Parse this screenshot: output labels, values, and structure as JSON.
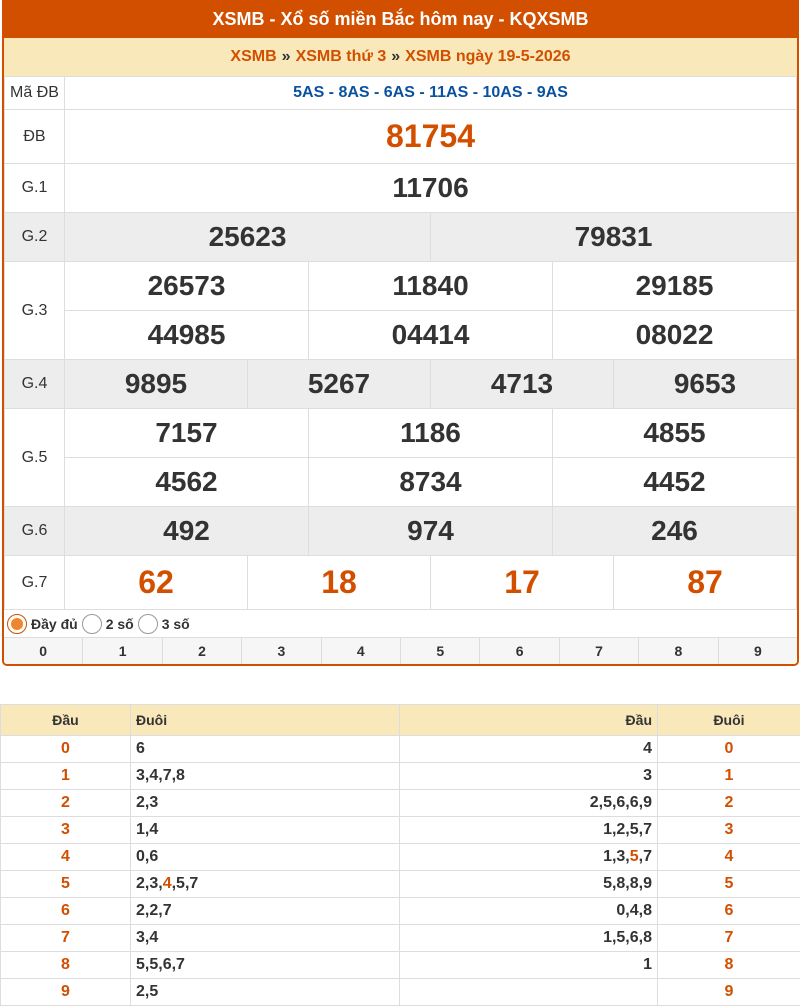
{
  "header": {
    "title": "XSMB - Xổ số miền Bắc hôm nay - KQXSMB"
  },
  "breadcrumb": {
    "items": [
      "XSMB",
      "XSMB thứ 3",
      "XSMB ngày 19-5-2026"
    ],
    "separator": "»"
  },
  "results": {
    "ma_db_label": "Mã ĐB",
    "ma_db_value": "5AS - 8AS - 6AS - 11AS - 10AS - 9AS",
    "db_label": "ĐB",
    "db": "81754",
    "g1_label": "G.1",
    "g1": "11706",
    "g2_label": "G.2",
    "g2": [
      "25623",
      "79831"
    ],
    "g3_label": "G.3",
    "g3": [
      "26573",
      "11840",
      "29185",
      "44985",
      "04414",
      "08022"
    ],
    "g4_label": "G.4",
    "g4": [
      "9895",
      "5267",
      "4713",
      "9653"
    ],
    "g5_label": "G.5",
    "g5": [
      "7157",
      "1186",
      "4855",
      "4562",
      "8734",
      "4452"
    ],
    "g6_label": "G.6",
    "g6": [
      "492",
      "974",
      "246"
    ],
    "g7_label": "G.7",
    "g7": [
      "62",
      "18",
      "17",
      "87"
    ]
  },
  "display_options": {
    "options": [
      "Đầy đủ",
      "2 số",
      "3 số"
    ],
    "selected": "Đầy đủ"
  },
  "digit_filter": [
    "0",
    "1",
    "2",
    "3",
    "4",
    "5",
    "6",
    "7",
    "8",
    "9"
  ],
  "loto_table": {
    "headers": [
      "Đầu",
      "Đuôi",
      "Đầu",
      "Đuôi"
    ],
    "rows": [
      {
        "head": "0",
        "tails": [
          "6"
        ],
        "heads": [
          "4"
        ],
        "tail": "0"
      },
      {
        "head": "1",
        "tails": [
          "3,4,7,8"
        ],
        "heads": [
          "3"
        ],
        "tail": "1"
      },
      {
        "head": "2",
        "tails": [
          "2,3"
        ],
        "heads": [
          "2,5,6,6,9"
        ],
        "tail": "2"
      },
      {
        "head": "3",
        "tails": [
          "1,4"
        ],
        "heads": [
          "1,2,5,7"
        ],
        "tail": "3"
      },
      {
        "head": "4",
        "tails": [
          "0,6"
        ],
        "heads": [
          "1,3,",
          "5",
          ",7"
        ],
        "tail": "4"
      },
      {
        "head": "5",
        "tails": [
          "2,3,",
          "4",
          ",5,7"
        ],
        "heads": [
          "5,8,8,9"
        ],
        "tail": "5"
      },
      {
        "head": "6",
        "tails": [
          "2,2,7"
        ],
        "heads": [
          "0,4,8"
        ],
        "tail": "6"
      },
      {
        "head": "7",
        "tails": [
          "3,4"
        ],
        "heads": [
          "1,5,6,8"
        ],
        "tail": "7"
      },
      {
        "head": "8",
        "tails": [
          "5,5,6,7"
        ],
        "heads": [
          "1"
        ],
        "tail": "8"
      },
      {
        "head": "9",
        "tails": [
          "2,5"
        ],
        "heads": [
          ""
        ],
        "tail": "9"
      }
    ]
  },
  "colors": {
    "brand": "#d24f00",
    "highlight": "#f9e8b9",
    "ma_db": "#0a52a0"
  }
}
